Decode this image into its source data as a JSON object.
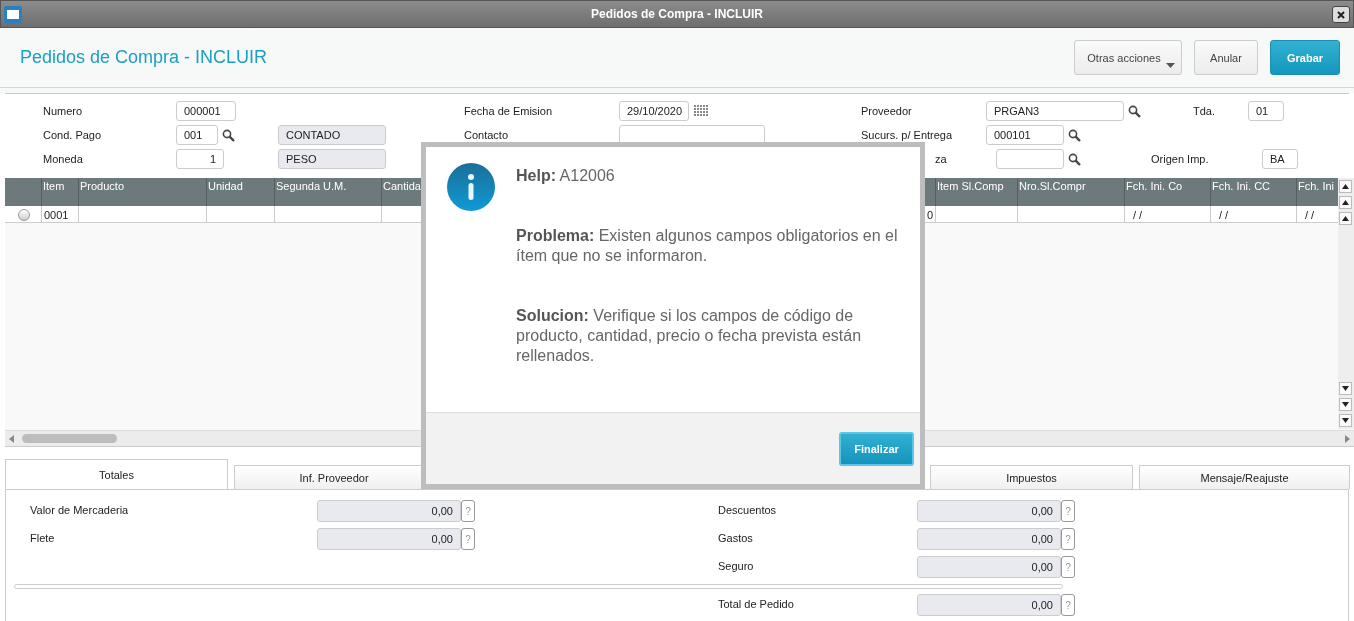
{
  "window": {
    "title": "Pedidos de Compra - INCLUIR"
  },
  "header": {
    "title": "Pedidos de Compra - INCLUIR",
    "buttons": [
      {
        "label": "Otras acciones",
        "kind": "menu"
      },
      {
        "label": "Anular",
        "kind": "default"
      },
      {
        "label": "Grabar",
        "kind": "primary"
      }
    ]
  },
  "form": {
    "rows": [
      [
        {
          "label": "Numero",
          "inputs": [
            {
              "kind": "field",
              "value": "000001"
            }
          ]
        },
        {
          "label": "Fecha de Emision",
          "inputs": [
            {
              "kind": "date-field",
              "value": "29/10/2020"
            }
          ]
        },
        {
          "label": "Proveedor",
          "inputs": [
            {
              "kind": "search-field",
              "value": "PRGAN3"
            }
          ]
        },
        {
          "label": "Tda.",
          "inputs": [
            {
              "kind": "field",
              "value": "01"
            }
          ]
        }
      ],
      [
        {
          "label": "Cond. Pago",
          "inputs": [
            {
              "kind": "search-field",
              "value": "001"
            },
            {
              "kind": "readonly",
              "value": "CONTADO"
            }
          ]
        },
        {
          "label": "Contacto",
          "inputs": [
            {
              "kind": "field"
            }
          ]
        },
        {
          "label": "Sucurs. p/ Entrega",
          "inputs": [
            {
              "kind": "search-field",
              "value": "000101"
            }
          ]
        }
      ],
      [
        {
          "label": "Moneda",
          "inputs": [
            {
              "kind": "number-field",
              "value": "1"
            },
            {
              "kind": "readonly",
              "value": "PESO"
            }
          ]
        },
        null,
        {
          "label": "za",
          "inputs": [
            {
              "kind": "search-field"
            }
          ]
        },
        {
          "label": "Origen Imp.",
          "inputs": [
            {
              "kind": "field",
              "value": "BA"
            }
          ]
        }
      ]
    ]
  },
  "table": {
    "columns": [
      "Item",
      "Producto",
      "Unidad",
      "Segunda U.M.",
      "Cantida",
      "Item Sl.Comp",
      "Nro.Sl.Compr",
      "Fch. Ini. Co",
      "Fch. Ini. CC",
      "Fch. Ini"
    ],
    "rows": [
      {
        "selected": false,
        "item": "0001",
        "hidden_column_tail": "0",
        "fch_ini_co": "/ /",
        "fch_ini_cc": "/ /",
        "fch_ini": "/ /"
      }
    ]
  },
  "tabs": [
    {
      "label": "Totales",
      "selected": true
    },
    {
      "label": "Inf. Proveedor",
      "selected": false
    },
    {
      "label": "Impuestos",
      "selected": false
    },
    {
      "label": "Mensaje/Reajuste",
      "selected": false
    }
  ],
  "totals": {
    "left": [
      {
        "label": "Valor de Mercaderia",
        "value": "0,00",
        "help": "?"
      },
      {
        "label": "Flete",
        "value": "0,00",
        "help": "?"
      }
    ],
    "right": [
      {
        "label": "Descuentos",
        "value": "0,00",
        "help": "?"
      },
      {
        "label": "Gastos",
        "value": "0,00",
        "help": "?"
      },
      {
        "label": "Seguro",
        "value": "0,00",
        "help": "?"
      }
    ],
    "total": {
      "label": "Total de Pedido",
      "value": "0,00",
      "help": "?"
    }
  },
  "dialog": {
    "heading": "**Help:** A12006",
    "paragraphs": [
      "**Problema:** Existen algunos campos obligatorios en el ítem que no se informaron.",
      "**Solucion:** Verifique si los campos de código de producto, cantidad, precio o fecha prevista están rellenados."
    ],
    "button": "Finalizar"
  }
}
